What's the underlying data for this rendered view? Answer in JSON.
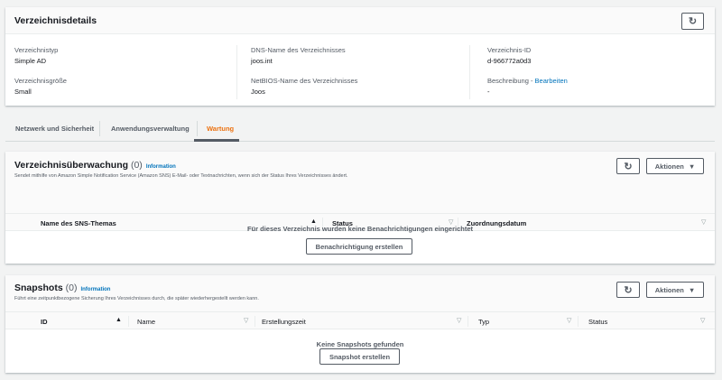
{
  "details": {
    "title": "Verzeichnisdetails",
    "fields": [
      {
        "label": "Verzeichnistyp",
        "value": "Simple AD"
      },
      {
        "label": "DNS-Name des Verzeichnisses",
        "value": "joos.int"
      },
      {
        "label": "Verzeichnis-ID",
        "value": "d-966772a0d3"
      },
      {
        "label": "Verzeichnisgröße",
        "value": "Small"
      },
      {
        "label": "NetBIOS-Name des Verzeichnisses",
        "value": "Joos"
      },
      {
        "label": "Beschreibung",
        "value": "-"
      }
    ],
    "desc_sep": " - ",
    "edit_link": "Bearbeiten"
  },
  "tabs": [
    {
      "label": "Netzwerk und Sicherheit"
    },
    {
      "label": "Anwendungsverwaltung"
    },
    {
      "label": "Wartung",
      "active": true
    }
  ],
  "monitoring": {
    "title": "Verzeichnisüberwachung",
    "count": "(0)",
    "info": "Information",
    "description": "Sendet mithilfe von Amazon Simple Notification Service (Amazon SNS) E-Mail- oder Textnachrichten, wenn sich der Status Ihres Verzeichnisses ändert.",
    "actions": "Aktionen",
    "columns": [
      "Name des SNS-Themas",
      "Status",
      "Zuordnungsdatum"
    ],
    "empty": "Für dieses Verzeichnis wurden keine Benachrichtigungen eingerichtet",
    "create": "Benachrichtigung erstellen"
  },
  "snapshots": {
    "title": "Snapshots",
    "count": "(0)",
    "info": "Information",
    "description": "Führt eine zeitpunktbezogene Sicherung Ihres Verzeichnisses durch, die später wiederhergestellt werden kann.",
    "actions": "Aktionen",
    "columns": [
      "ID",
      "Name",
      "Erstellungszeit",
      "Typ",
      "Status"
    ],
    "empty": "Keine Snapshots gefunden",
    "create": "Snapshot erstellen"
  },
  "colors": {
    "accent": "#ec7211",
    "link": "#0073bb"
  }
}
